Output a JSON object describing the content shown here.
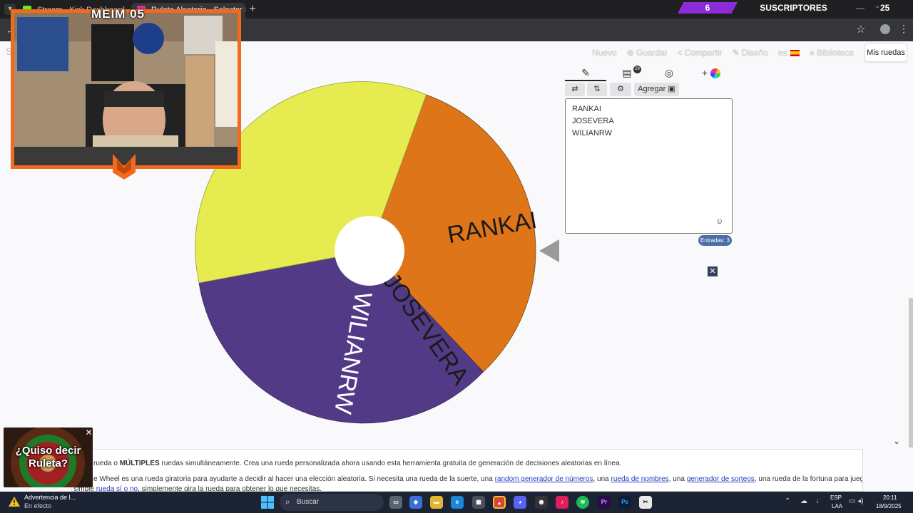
{
  "browser": {
    "tabs": [
      {
        "label": "Stream - Kick Dashboard"
      },
      {
        "label": "Ruleta Aleatoria - Selector De"
      }
    ],
    "new_tab_glyph": "+"
  },
  "stream_overlay": {
    "cam_title": "MEIM 05",
    "subscriber_count": "6",
    "subscriber_label": "SUSCRIPTORES",
    "subscriber_extra": "25",
    "accent_color": "#f26a1b",
    "badge_color": "#8c2bd8"
  },
  "site_nav": {
    "new": "Nuevo",
    "save": "Guardar",
    "share": "Compartir",
    "design": "Diseño",
    "lang": "es",
    "library": "Biblioteca",
    "my_wheels": "Mis ruedas"
  },
  "wheel": {
    "segments": [
      {
        "label": "RANKAI",
        "color": "#df7519"
      },
      {
        "label": "WILIANRW",
        "color": "#533a86"
      },
      {
        "label": "JOSEVERA",
        "color": "#e6ec50"
      }
    ]
  },
  "editor": {
    "results_badge": "29",
    "add_image_label": "Agregar",
    "entries": [
      "RANKAI",
      "JOSEVERA",
      "WILIANRW"
    ],
    "entries_count": "Entradas: 3"
  },
  "info": {
    "line1_pre": "rueda o ",
    "line1_bold": "MÚLTIPLES",
    "line1_post": " ruedas simultáneamente. Crea una rueda personalizada ahora usando esta herramienta gratuita de generación de decisiones aleatorias en línea.",
    "line2_a": "e Wheel es una rueda giratoria para ayudarte a decidir al hacer una elección aleatoria. Si necesita una rueda de la suerte, una ",
    "link1": "random generador de números",
    "line2_b": ", una ",
    "link2": "rueda de nombres",
    "line2_c": ", una ",
    "link3": "generador de sorteos",
    "line2_d": ", una rueda de la fortuna para juegos o una",
    "line3_a": "simple ",
    "link4": "rueda sí o no",
    "line3_b": ", simplemente gira la rueda para obtener lo que necesitas."
  },
  "ad": {
    "text_line1": "¿Quiso decir",
    "text_line2": "Ruleta?"
  },
  "taskbar": {
    "notification_title": "Advertencia de l...",
    "notification_sub": "En efecto",
    "search_placeholder": "Buscar",
    "lang_line1": "ESP",
    "lang_line2": "LAA",
    "time": "20:11",
    "date": "18/9/2025"
  }
}
